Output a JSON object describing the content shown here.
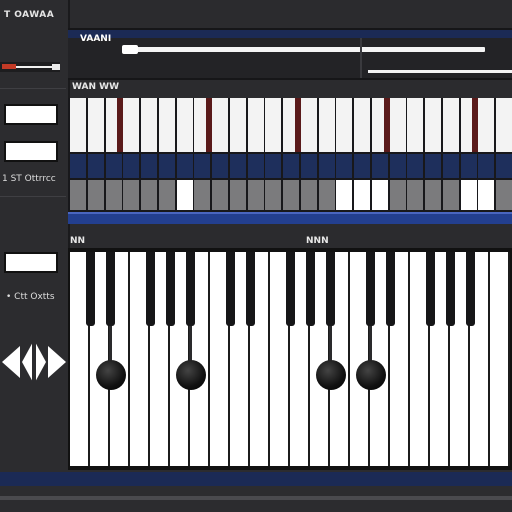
{
  "sidebar": {
    "title": "T OAWAA",
    "label_1": "1 ST Ottrrcc",
    "label_2": "• Ctt Oxtts"
  },
  "header": {
    "title": "VAANI",
    "slider_1_level": 0.95,
    "slider_2_level": 0.34
  },
  "sections": {
    "grid_label": "WAN WW",
    "piano_left_label": "NN",
    "piano_right_label": "NNN"
  },
  "grid": {
    "columns": 25,
    "lit_cells": [
      6,
      15,
      16,
      17,
      22,
      23
    ]
  },
  "piano": {
    "white_keys": 22,
    "black_keys_with_knobs": [
      1,
      5,
      12,
      14,
      16
    ]
  },
  "colors": {
    "background": "#2b2b2e",
    "accent_navy": "#1e2f5c",
    "accent_blue": "#233f8f",
    "accent_red": "#c23a26",
    "key_white": "#ffffff",
    "key_black": "#161618"
  },
  "icons": {
    "nav": "diamond-nav-icon"
  }
}
